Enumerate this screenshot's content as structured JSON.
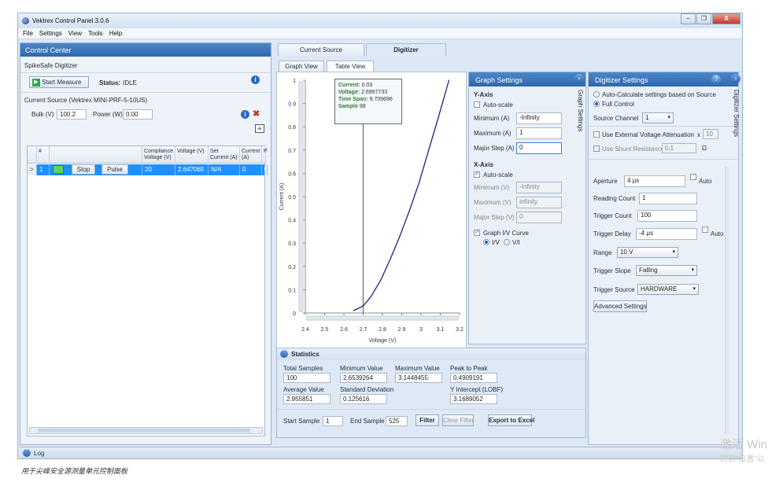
{
  "window": {
    "title": "Vektrex Control Panel 3.0.6",
    "buttons": [
      "–",
      "❐",
      "X"
    ]
  },
  "menu": [
    "File",
    "Settings",
    "View",
    "Tools",
    "Help"
  ],
  "control_center": {
    "title": "Control Center",
    "device": "SpikeSafe Digitizer",
    "start_measure": "Start Measure",
    "status_label": "Status:",
    "status_value": "IDLE",
    "current_source": "Current Source (Vektrex MINI-PRF-5-10US)",
    "bulk_label": "Bulk (V)",
    "bulk_value": "100.2",
    "power_label": "Power (W)",
    "power_value": "0.00",
    "table": {
      "headers": [
        "#",
        "Compliance Voltage (V)",
        "Voltage (V)",
        "Set Current (A)",
        "Current (A)",
        "P"
      ],
      "row": {
        "index": "1",
        "stop": "Stop",
        "pulse": "Pulse",
        "compliance": "20",
        "voltage": "2.647065",
        "set_current": "N/A",
        "current": "0",
        "p": "0"
      }
    }
  },
  "tabs": {
    "current_source": "Current Source",
    "digitizer": "Digitizer"
  },
  "subtabs": {
    "graph_view": "Graph View",
    "table_view": "Table View"
  },
  "tooltip": {
    "current_label": "Current:",
    "current_value": "0.03",
    "voltage_label": "Voltage:",
    "voltage_value": "2.6997733",
    "timespan_label": "Time Span:",
    "timespan_value": "9.709696",
    "sample_label": "Sample",
    "sample_value": "98"
  },
  "chart_data": {
    "type": "line",
    "xlabel": "Voltage (V)",
    "ylabel": "Current (A)",
    "xlim": [
      2.4,
      3.2
    ],
    "ylim": [
      0,
      1
    ],
    "xticks": [
      "2.4",
      "2.5",
      "2.6",
      "2.7",
      "2.8",
      "2.9",
      "3",
      "3.1",
      "3.2"
    ],
    "yticks": [
      "0",
      "0.1",
      "0.2",
      "0.3",
      "0.4",
      "0.5",
      "0.6",
      "0.7",
      "0.8",
      "0.9",
      "1"
    ],
    "x": [
      2.65,
      2.7,
      2.74,
      2.79,
      2.84,
      2.89,
      2.94,
      2.99,
      3.04,
      3.09,
      3.145
    ],
    "y": [
      0.01,
      0.03,
      0.07,
      0.14,
      0.23,
      0.33,
      0.44,
      0.56,
      0.7,
      0.84,
      1.0
    ],
    "cursor_x": 2.6997733,
    "grid": false
  },
  "graph_settings": {
    "title": "Graph Settings",
    "side_label": "Graph Settings",
    "y_axis": "Y-Axis",
    "x_axis": "X-Axis",
    "auto_scale": "Auto-scale",
    "y_min_label": "Minimum (A)",
    "y_min": "-Infinity",
    "y_max_label": "Maximum (A)",
    "y_max": "1",
    "y_step_label": "Major Step (A)",
    "y_step": "0",
    "x_min_label": "Minimum (V)",
    "x_min": "-Infinity",
    "x_max_label": "Maximum (V)",
    "x_max": "Infinity",
    "x_step_label": "Major Step (V)",
    "x_step": "0",
    "graph_iv": "Graph I/V Curve",
    "iv": "I/V",
    "vi": "V/I"
  },
  "digitizer_settings": {
    "title": "Digitizer Settings",
    "side_label": "Digitizer Settings",
    "auto_calc": "Auto-Calculate settings based on Source",
    "full_control": "Full Control",
    "source_channel_label": "Source Channel",
    "source_channel": "1",
    "ext_voltage": "Use External Voltage Attenuation",
    "ext_x": "x",
    "ext_value": "10",
    "shunt": "Use Shunt Resistance",
    "shunt_value": "0.1",
    "ohm": "Ω",
    "aperture_label": "Aperture",
    "aperture": "4 μs",
    "auto": "Auto",
    "reading_count_label": "Reading Count",
    "reading_count": "1",
    "trigger_count_label": "Trigger Count",
    "trigger_count": "100",
    "trigger_delay_label": "Trigger Delay",
    "trigger_delay": "-4 μs",
    "auto2": "Auto",
    "range_label": "Range",
    "range": "10 V",
    "trigger_slope_label": "Trigger Slope",
    "trigger_slope": "Falling",
    "trigger_source_label": "Trigger Source",
    "trigger_source": "HARDWARE",
    "advanced": "Advanced Settings"
  },
  "statistics": {
    "title": "Statistics",
    "total_samples_label": "Total Samples",
    "total_samples": "100",
    "min_label": "Minimum Value",
    "min": "2.6539264",
    "max_label": "Maximum Value",
    "max": "3.1448455",
    "p2p_label": "Peak to Peak",
    "p2p": "0.4909191",
    "avg_label": "Average Value",
    "avg": "2.955851",
    "std_label": "Standard Deviation",
    "std": "0.125616",
    "yint_label": "Y Intercept (LOBF)",
    "yint": "3.1689052",
    "start_label": "Start Sample",
    "start": "1",
    "end_label": "End Sample",
    "end": "525",
    "filter": "Filter",
    "clear_filter": "Clear Filter",
    "export": "Export to Excel"
  },
  "log": "Log",
  "watermark": {
    "line1": "激活 Win",
    "line2": "转到\"设置\"以"
  },
  "caption": "用于尖峰安全源测量单元控制面板",
  "colors": {
    "accent": "#2f68ad",
    "row_select": "#1e90ff",
    "curve": "#1a237e"
  }
}
